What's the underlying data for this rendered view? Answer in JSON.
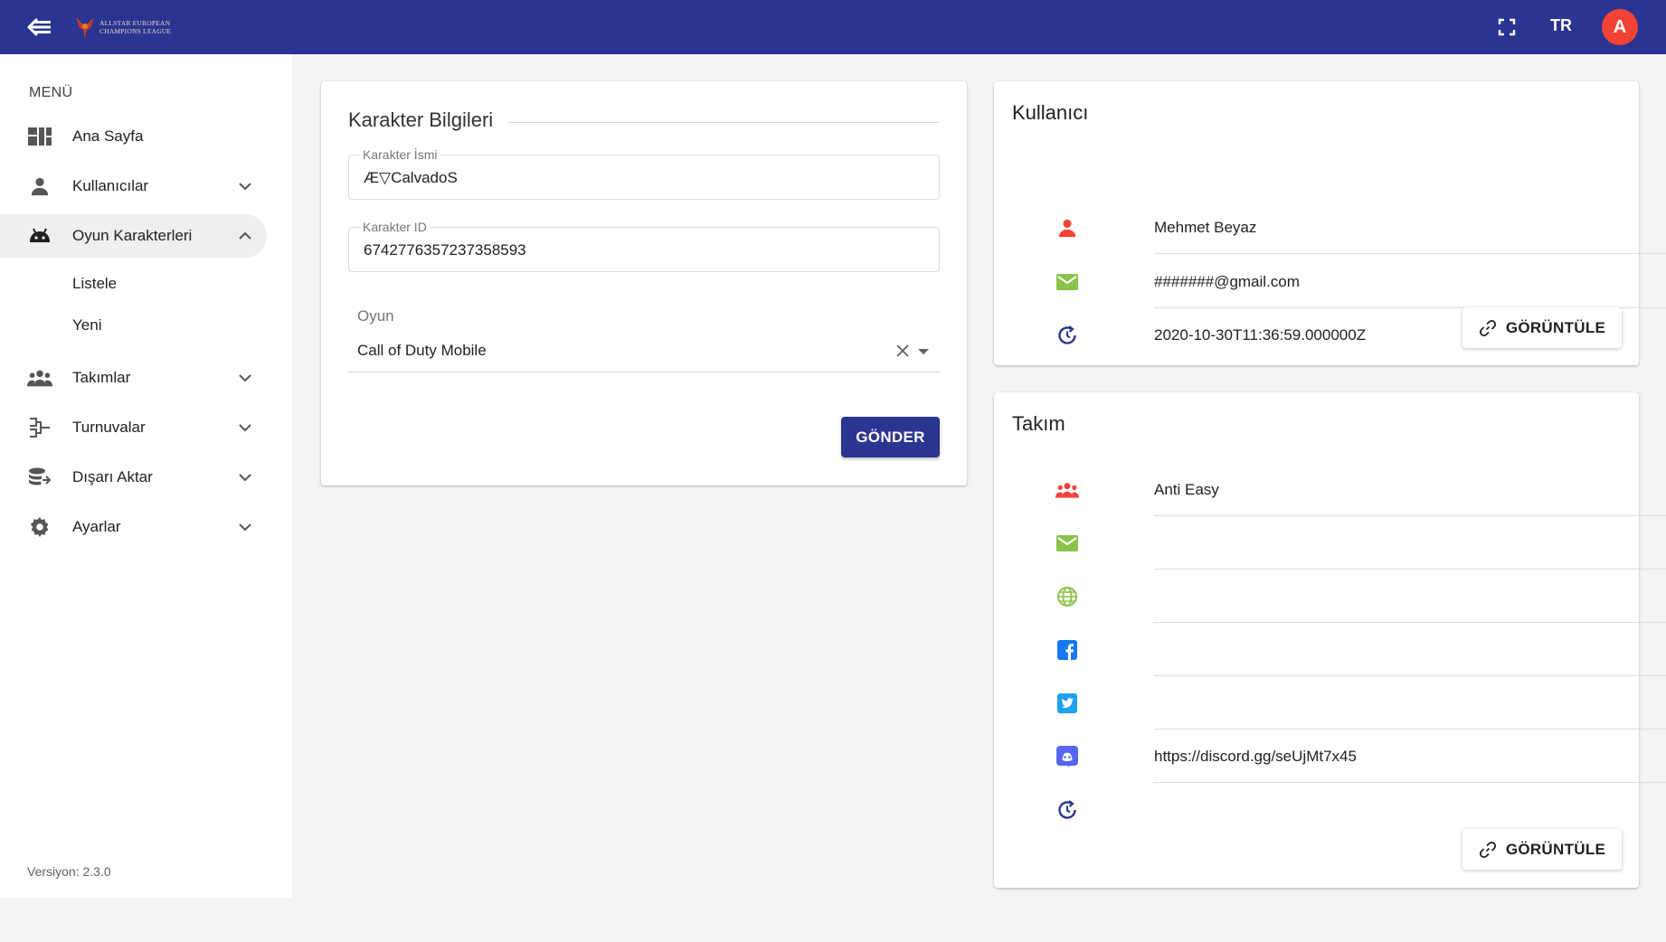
{
  "header": {
    "logo_line1": "Allstar European",
    "logo_line2": "Champions League",
    "language": "TR",
    "avatar_initial": "A"
  },
  "sidebar": {
    "menu_title": "MENÜ",
    "items": [
      {
        "label": "Ana Sayfa",
        "icon": "dashboard-icon"
      },
      {
        "label": "Kullanıcılar",
        "icon": "person-icon"
      },
      {
        "label": "Oyun Karakterleri",
        "icon": "android-icon"
      },
      {
        "label": "Takımlar",
        "icon": "group-icon"
      },
      {
        "label": "Turnuvalar",
        "icon": "bracket-icon"
      },
      {
        "label": "Dışarı Aktar",
        "icon": "export-icon"
      },
      {
        "label": "Ayarlar",
        "icon": "gear-icon"
      }
    ],
    "subitems": [
      "Listele",
      "Yeni"
    ],
    "version": "Versiyon: 2.3.0"
  },
  "form": {
    "title": "Karakter Bilgileri",
    "name_label": "Karakter İsmi",
    "name_value": "Æ▽CalvadoS",
    "id_label": "Karakter ID",
    "id_value": "6742776357237358593",
    "game_label": "Oyun",
    "game_value": "Call of Duty Mobile",
    "submit_label": "GÖNDER"
  },
  "user_card": {
    "title": "Kullanıcı",
    "name": "Mehmet Beyaz",
    "email": "#######@gmail.com",
    "date": "2020-10-30T11:36:59.000000Z",
    "view_label": "GÖRÜNTÜLE"
  },
  "team_card": {
    "title": "Takım",
    "name": "Anti Easy",
    "email": "",
    "website": "",
    "facebook": "",
    "twitter": "",
    "discord": "https://discord.gg/seUjMt7x45",
    "date": "",
    "view_label": "GÖRÜNTÜLE"
  },
  "colors": {
    "primary": "#2a3491",
    "avatar": "#f44336",
    "user_icon": "#f44336",
    "mail_icon": "#8bc34a",
    "facebook": "#1877f2",
    "twitter": "#1da1f2",
    "discord": "#5865f2",
    "history": "#2a3491"
  }
}
